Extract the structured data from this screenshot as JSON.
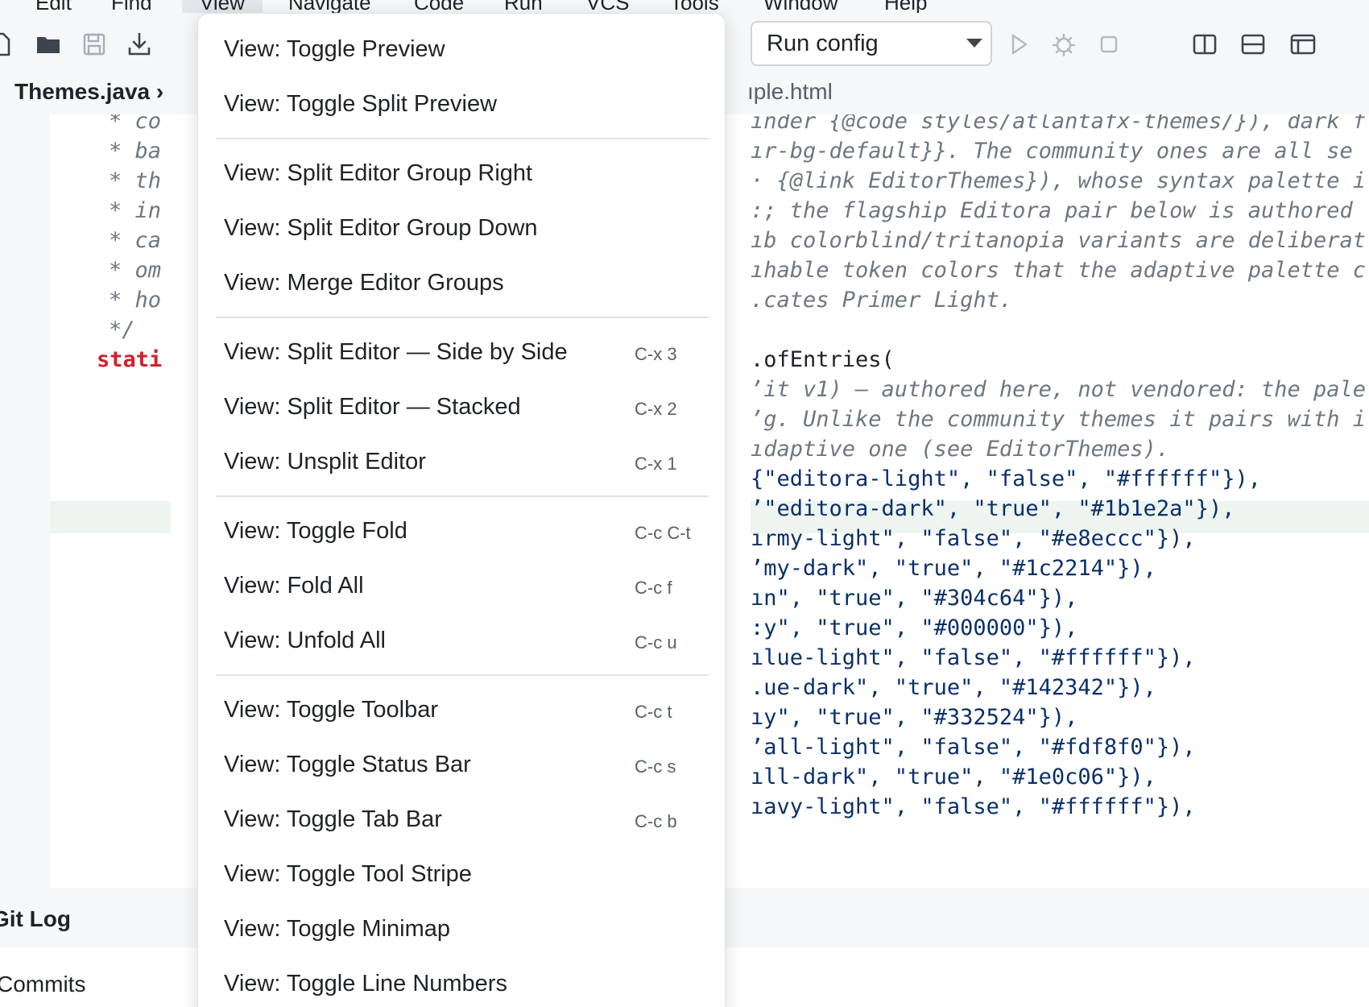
{
  "menubar": {
    "items": [
      {
        "label": "Edit"
      },
      {
        "label": "Find"
      },
      {
        "label": "View"
      },
      {
        "label": "Navigate"
      },
      {
        "label": "Code"
      },
      {
        "label": "Run"
      },
      {
        "label": "VCS"
      },
      {
        "label": "Tools"
      },
      {
        "label": "Window"
      },
      {
        "label": "Help"
      }
    ]
  },
  "toolbar": {
    "icons": [
      "new-file-icon",
      "open-folder-icon",
      "save-icon",
      "download-icon"
    ],
    "run_config": "Run config",
    "run_icons": [
      "run-icon",
      "debug-icon",
      "stop-icon"
    ],
    "layout_icons": [
      "split-vertical-icon",
      "split-horizontal-icon",
      "panel-layout-icon"
    ]
  },
  "tabs": {
    "left": "Themes.java ›",
    "right": "ıple.html"
  },
  "editor_left": {
    "lines": [
      "* co",
      "* ba",
      "* th",
      "* in",
      "* ca",
      "* om",
      "* ho",
      "*/",
      "stati"
    ]
  },
  "editor_right": {
    "lines": [
      "ınder {@code styles/atlantafx-themes/}), dark f",
      "ır-bg-default}}. The community ones are all se",
      "· {@link EditorThemes}), whose syntax palette i",
      ":; the flagship Editora pair below is authored",
      "ıb colorblind/tritanopia variants are deliberat",
      "ıhable token colors that the adaptive palette c",
      ".cates Primer Light.",
      "",
      ".ofEntries(",
      "ʼit v1) — authored here, not vendored: the pale",
      "ʼg. Unlike the community themes it pairs with i",
      "ıdaptive one (see EditorThemes).",
      "{\"editora-light\", \"false\", \"#ffffff\"}),",
      "ʼ\"editora-dark\", \"true\", \"#1b1e2a\"}),",
      "ırmy-light\", \"false\", \"#e8eccc\"}),",
      "ʼmy-dark\", \"true\", \"#1c2214\"}),",
      "ın\", \"true\", \"#304c64\"}),",
      ":y\", \"true\", \"#000000\"}),",
      "ılue-light\", \"false\", \"#ffffff\"}),",
      ".ue-dark\", \"true\", \"#142342\"}),",
      "ıy\", \"true\", \"#332524\"}),",
      "ʼall-light\", \"false\", \"#fdf8f0\"}),",
      "ıll-dark\", \"true\", \"#1e0c06\"}),",
      "ıavy-light\", \"false\", \"#ffffff\"}),"
    ]
  },
  "bottom_panel": {
    "title": "Git Log",
    "subtitle": "Commits"
  },
  "view_menu": {
    "groups": [
      [
        {
          "label": "View: Toggle Preview",
          "shortcut": ""
        },
        {
          "label": "View: Toggle Split Preview",
          "shortcut": ""
        }
      ],
      [
        {
          "label": "View: Split Editor Group Right",
          "shortcut": ""
        },
        {
          "label": "View: Split Editor Group Down",
          "shortcut": ""
        },
        {
          "label": "View: Merge Editor Groups",
          "shortcut": ""
        }
      ],
      [
        {
          "label": "View: Split Editor — Side by Side",
          "shortcut": "C-x 3"
        },
        {
          "label": "View: Split Editor — Stacked",
          "shortcut": "C-x 2"
        },
        {
          "label": "View: Unsplit Editor",
          "shortcut": "C-x 1"
        }
      ],
      [
        {
          "label": "View: Toggle Fold",
          "shortcut": "C-c C-t"
        },
        {
          "label": "View: Fold All",
          "shortcut": "C-c f"
        },
        {
          "label": "View: Unfold All",
          "shortcut": "C-c u"
        }
      ],
      [
        {
          "label": "View: Toggle Toolbar",
          "shortcut": "C-c t"
        },
        {
          "label": "View: Toggle Status Bar",
          "shortcut": "C-c s"
        },
        {
          "label": "View: Toggle Tab Bar",
          "shortcut": "C-c b"
        },
        {
          "label": "View: Toggle Tool Stripe",
          "shortcut": ""
        },
        {
          "label": "View: Toggle Minimap",
          "shortcut": ""
        },
        {
          "label": "View: Toggle Line Numbers",
          "shortcut": ""
        }
      ]
    ]
  }
}
